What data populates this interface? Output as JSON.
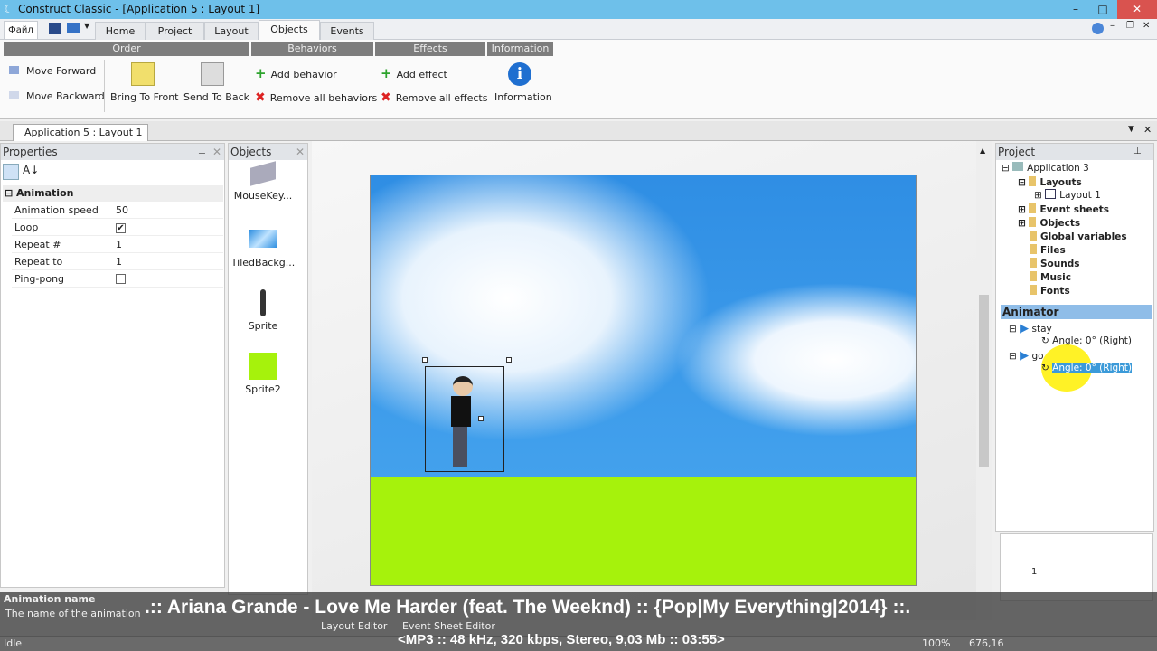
{
  "window": {
    "title": "Construct Classic - [Application 5 : Layout 1]",
    "controls": [
      "–",
      "□",
      "✕"
    ]
  },
  "ribbon": {
    "file_button": "Файл",
    "tabs": [
      {
        "label": "Home"
      },
      {
        "label": "Project"
      },
      {
        "label": "Layout"
      },
      {
        "label": "Objects",
        "active": true
      },
      {
        "label": "Events"
      }
    ],
    "groups": [
      "Order",
      "Behaviors",
      "Effects",
      "Information"
    ],
    "buttons": {
      "move_forward": "Move Forward",
      "move_backward": "Move Backward",
      "bring_to_front": "Bring To Front",
      "send_to_back": "Send To Back",
      "add_behavior": "Add behavior",
      "remove_all_behaviors": "Remove all behaviors",
      "add_effect": "Add effect",
      "remove_all_effects": "Remove all effects",
      "information": "Information"
    }
  },
  "doc_tab": "Application 5 : Layout 1",
  "properties": {
    "title": "Properties",
    "section": "Animation",
    "rows": [
      {
        "key": "Animation speed",
        "value": "50"
      },
      {
        "key": "Loop",
        "checked": true
      },
      {
        "key": "Repeat #",
        "value": "1"
      },
      {
        "key": "Repeat to",
        "value": "1"
      },
      {
        "key": "Ping-pong",
        "checked": false
      }
    ],
    "help_title": "Animation name",
    "help_text": "The name of the animation"
  },
  "objects": {
    "title": "Objects",
    "items": [
      {
        "label": "MouseKey...",
        "icon": "keyboard-mouse-icon"
      },
      {
        "label": "TiledBackg...",
        "icon": "tiled-background-icon"
      },
      {
        "label": "Sprite",
        "icon": "sprite-character-icon"
      },
      {
        "label": "Sprite2",
        "icon": "green-square-icon"
      }
    ]
  },
  "layout_editor": {
    "tabs": [
      "Layout Editor",
      "Event Sheet Editor"
    ],
    "colors": {
      "sky": "#3d9be8",
      "grass": "#a6f20c"
    }
  },
  "project": {
    "title": "Project",
    "root": "Application 3",
    "items": [
      "Layouts",
      "Layout 1",
      "Event sheets",
      "Objects",
      "Global variables",
      "Files",
      "Sounds",
      "Music",
      "Fonts"
    ]
  },
  "animator": {
    "title": "Animator",
    "animations": [
      {
        "name": "stay",
        "angle": "Angle: 0° (Right)"
      },
      {
        "name": "go",
        "angle": "Angle: 0° (Right)"
      }
    ],
    "frame_number": "1"
  },
  "status": {
    "text": "Idle",
    "zoom": "100%",
    "coords": "676,16"
  },
  "overlay": {
    "caption": ".:: Ariana Grande - Love Me Harder (feat. The Weeknd) :: {Pop|My Everything|2014} ::.",
    "subcaption": "<MP3 :: 48 kHz, 320 kbps, Stereo, 9,03 Mb :: 03:55>"
  }
}
